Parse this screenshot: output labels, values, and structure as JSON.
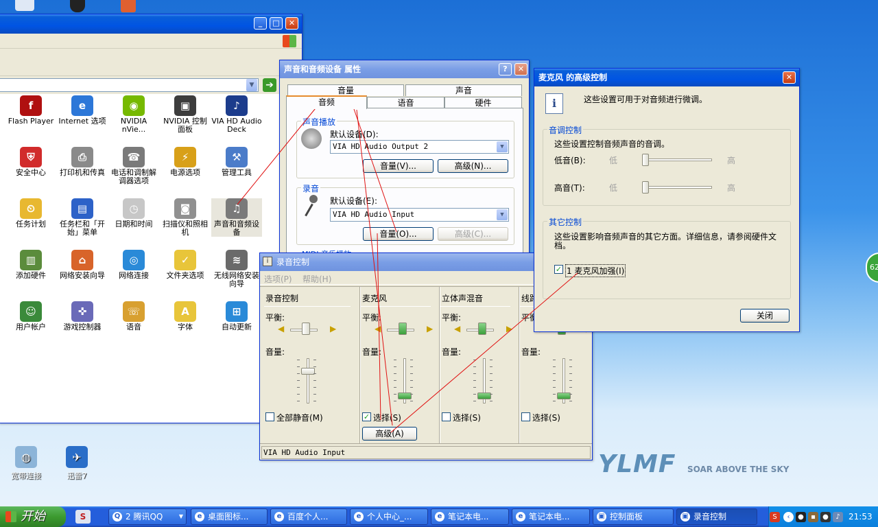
{
  "colors": {
    "accent": "#0054e3",
    "taskbar": "#245edb",
    "start": "#3c9a2f"
  },
  "control_panel": {
    "icons": [
      {
        "label": "Flash Player",
        "icon": "flash-icon",
        "color": "#b01010",
        "glyph": "f"
      },
      {
        "label": "Internet 选项",
        "icon": "globe-icon",
        "color": "#2c77d8",
        "glyph": "e"
      },
      {
        "label": "NVIDIA nVie...",
        "icon": "nvidia-icon",
        "color": "#76b900",
        "glyph": "◉"
      },
      {
        "label": "NVIDIA 控制面板",
        "icon": "nvidia-panel-icon",
        "color": "#3d3d3d",
        "glyph": "▣"
      },
      {
        "label": "VIA HD Audio Deck",
        "icon": "via-icon",
        "color": "#1c3c8c",
        "glyph": "♪"
      },
      {
        "label": "安全中心",
        "icon": "shield-icon",
        "color": "#d12b2b",
        "glyph": "⛨"
      },
      {
        "label": "打印机和传真",
        "icon": "printer-icon",
        "color": "#8a8a8a",
        "glyph": "⎙"
      },
      {
        "label": "电话和调制解调器选项",
        "icon": "phone-icon",
        "color": "#7a7a7a",
        "glyph": "☎"
      },
      {
        "label": "电源选项",
        "icon": "power-icon",
        "color": "#d8a019",
        "glyph": "⚡"
      },
      {
        "label": "管理工具",
        "icon": "tools-icon",
        "color": "#4b7cc9",
        "glyph": "⚒"
      },
      {
        "label": "任务计划",
        "icon": "folder-clock-icon",
        "color": "#e8b830",
        "glyph": "⏲"
      },
      {
        "label": "任务栏和「开始」菜单",
        "icon": "taskbar-icon",
        "color": "#2d62c8",
        "glyph": "▤"
      },
      {
        "label": "日期和时间",
        "icon": "clock-icon",
        "color": "#c7c7c7",
        "glyph": "◷"
      },
      {
        "label": "扫描仪和照相机",
        "icon": "camera-icon",
        "color": "#909090",
        "glyph": "◙"
      },
      {
        "label": "声音和音频设备",
        "icon": "speaker-icon",
        "color": "#7a7a7a",
        "glyph": "♫"
      },
      {
        "label": "添加硬件",
        "icon": "hardware-icon",
        "color": "#5b8c3c",
        "glyph": "▥"
      },
      {
        "label": "网络安装向导",
        "icon": "home-network-icon",
        "color": "#d8642a",
        "glyph": "⌂"
      },
      {
        "label": "网络连接",
        "icon": "network-icon",
        "color": "#2a8ad8",
        "glyph": "◎"
      },
      {
        "label": "文件夹选项",
        "icon": "folder-icon",
        "color": "#e8c53a",
        "glyph": "✓"
      },
      {
        "label": "无线网络安装向导",
        "icon": "wireless-icon",
        "color": "#6a6a6a",
        "glyph": "≋"
      },
      {
        "label": "用户帐户",
        "icon": "users-icon",
        "color": "#3a8a3a",
        "glyph": "☺"
      },
      {
        "label": "游戏控制器",
        "icon": "gamepad-icon",
        "color": "#6a6ab8",
        "glyph": "✜"
      },
      {
        "label": "语音",
        "icon": "speech-icon",
        "color": "#d8a030",
        "glyph": "☏"
      },
      {
        "label": "字体",
        "icon": "font-folder-icon",
        "color": "#e8c53a",
        "glyph": "A"
      },
      {
        "label": "自动更新",
        "icon": "windows-update-icon",
        "color": "#2a8ad8",
        "glyph": "⊞"
      }
    ]
  },
  "sound_dialog": {
    "title": "声音和音频设备 属性",
    "tabs_top": [
      "音量",
      "声音"
    ],
    "tabs_bottom": [
      "音频",
      "语音",
      "硬件"
    ],
    "playback": {
      "label": "声音播放",
      "default_label": "默认设备(D):",
      "device": "VIA HD Audio Output 2",
      "volume_btn": "音量(V)...",
      "advanced_btn": "高级(N)..."
    },
    "recording": {
      "label": "录音",
      "default_label": "默认设备(E):",
      "device": "VIA HD Audio Input",
      "volume_btn": "音量(O)...",
      "advanced_btn": "高级(C)..."
    },
    "midi_label": "MIDI 音乐播放"
  },
  "mixer": {
    "title": "录音控制",
    "menu": [
      "选项(P)",
      "帮助(H)"
    ],
    "balance_label": "平衡:",
    "volume_label": "音量:",
    "columns": [
      {
        "name": "录音控制",
        "check": "全部静音(M)",
        "checked": false
      },
      {
        "name": "麦克风",
        "check": "选择(S)",
        "checked": true,
        "advanced": "高级(A)"
      },
      {
        "name": "立体声混音",
        "check": "选择(S)",
        "checked": false
      },
      {
        "name": "线路",
        "check": "选择(S)",
        "checked": false
      }
    ],
    "status": "VIA HD Audio Input"
  },
  "advanced_dialog": {
    "title": "麦克风 的高级控制",
    "intro": "这些设置可用于对音频进行微调。",
    "tone": {
      "label": "音调控制",
      "desc": "这些设置控制音频声音的音调。",
      "bass": "低音(B):",
      "treble": "高音(T):",
      "low": "低",
      "high": "高"
    },
    "other": {
      "label": "其它控制",
      "desc": "这些设置影响音频声音的其它方面。详细信息，请参阅硬件文档。",
      "boost": "1  麦克风加强(I)",
      "boost_checked": true
    },
    "close": "关闭"
  },
  "desktop": {
    "icons": [
      {
        "label": "宽带连接",
        "icon": "broadband-icon"
      },
      {
        "label": "迅雷7",
        "icon": "thunder-icon"
      }
    ],
    "brand": "SOAR ABOVE THE SKY",
    "logo": "YLMF",
    "side_badge": "62"
  },
  "taskbar": {
    "start": "开始",
    "items": [
      {
        "label": "2 腾讯QQ",
        "icon": "qq-icon"
      },
      {
        "label": "桌面图标...",
        "icon": "ie-icon"
      },
      {
        "label": "百度个人...",
        "icon": "ie-icon"
      },
      {
        "label": "个人中心_...",
        "icon": "ie-icon"
      },
      {
        "label": "笔记本电...",
        "icon": "ie-icon"
      },
      {
        "label": "笔记本电...",
        "icon": "ie-icon"
      },
      {
        "label": "控制面板",
        "icon": "control-panel-icon"
      },
      {
        "label": "录音控制",
        "icon": "mixer-icon"
      }
    ],
    "clock": "21:53"
  }
}
